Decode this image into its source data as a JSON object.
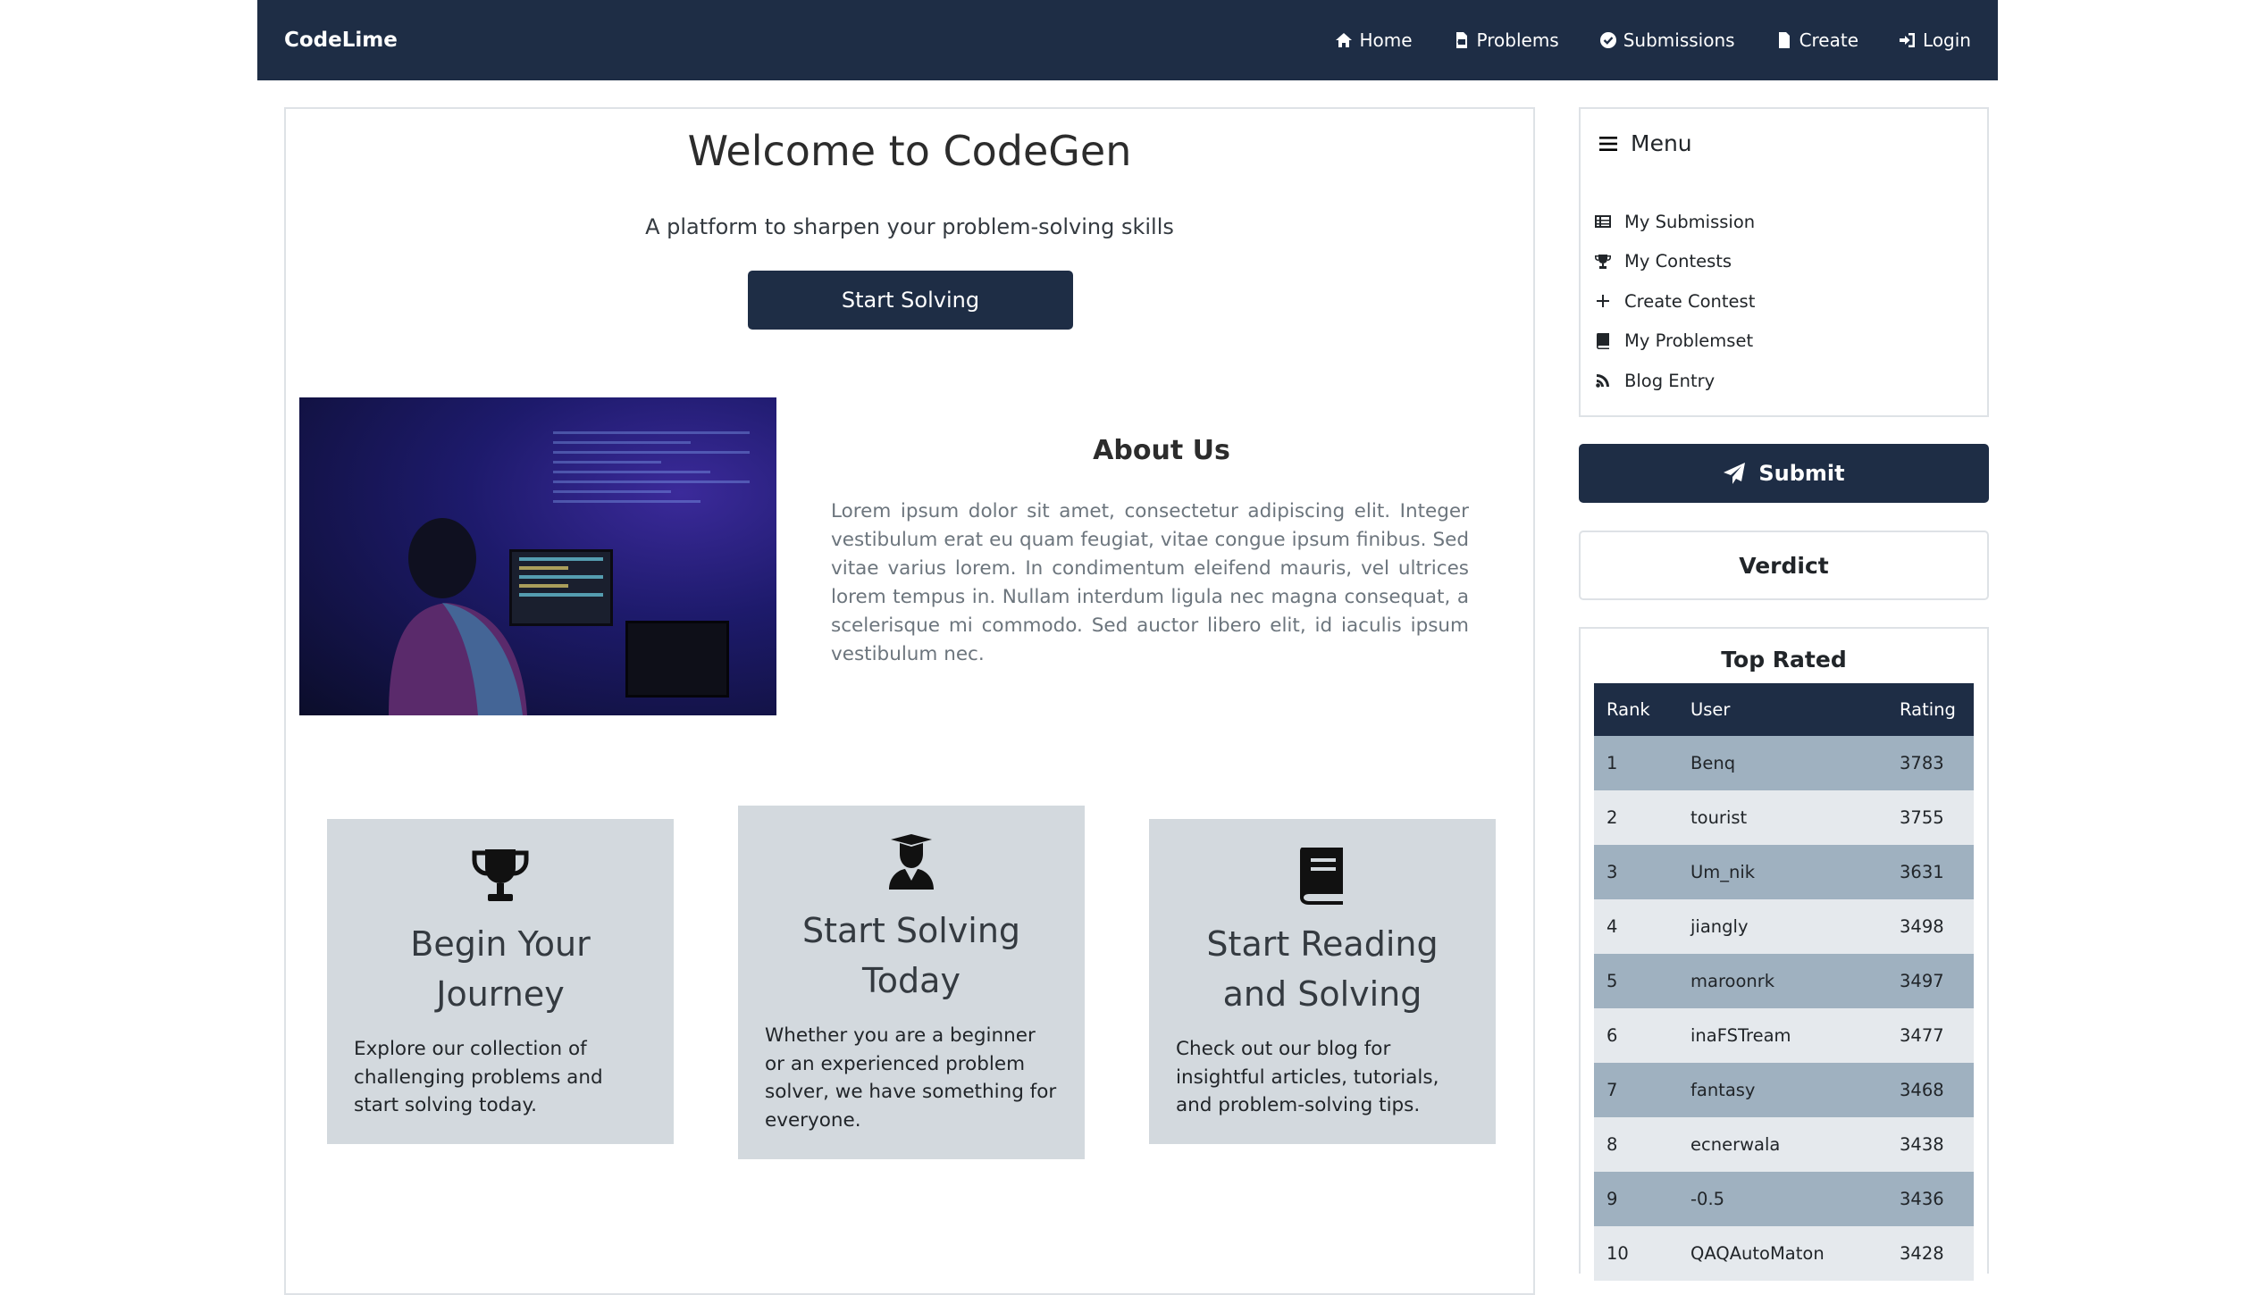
{
  "navbar": {
    "brand": "CodeLime",
    "items": [
      {
        "label": "Home",
        "icon": "home-icon"
      },
      {
        "label": "Problems",
        "icon": "file-code-icon"
      },
      {
        "label": "Submissions",
        "icon": "check-circle-icon"
      },
      {
        "label": "Create",
        "icon": "file-icon"
      },
      {
        "label": "Login",
        "icon": "login-icon"
      }
    ]
  },
  "hero": {
    "title": "Welcome to CodeGen",
    "subtitle": "A platform to sharpen your problem-solving skills",
    "button": "Start Solving"
  },
  "about": {
    "title": "About Us",
    "text": "Lorem ipsum dolor sit amet, consectetur adipiscing elit. Integer vestibulum erat eu quam feugiat, vitae congue ipsum finibus. Sed vitae varius lorem. In condimentum eleifend mauris, vel ultrices lorem tempus in. Nullam interdum ligula nec magna consequat, a scelerisque mi commodo. Sed auctor libero elit, id iaculis ipsum vestibulum nec."
  },
  "cards": [
    {
      "title": "Begin Your Journey",
      "text": "Explore our collection of challenging problems and start solving today.",
      "icon": "trophy-icon"
    },
    {
      "title": "Start Solving Today",
      "text": "Whether you are a beginner or an experienced problem solver, we have something for everyone.",
      "icon": "graduate-icon"
    },
    {
      "title": "Start Reading and Solving",
      "text": "Check out our blog for insightful articles, tutorials, and problem-solving tips.",
      "icon": "book-icon"
    }
  ],
  "menu": {
    "title": "Menu",
    "items": [
      {
        "label": "My Submission",
        "icon": "table-icon"
      },
      {
        "label": "My Contests",
        "icon": "trophy-icon"
      },
      {
        "label": "Create Contest",
        "icon": "plus-icon"
      },
      {
        "label": "My Problemset",
        "icon": "book-icon"
      },
      {
        "label": "Blog Entry",
        "icon": "blog-icon"
      }
    ]
  },
  "submit_label": "Submit",
  "verdict_label": "Verdict",
  "top_rated": {
    "title": "Top Rated",
    "headers": [
      "Rank",
      "User",
      "Rating"
    ],
    "rows": [
      [
        "1",
        "Benq",
        "3783"
      ],
      [
        "2",
        "tourist",
        "3755"
      ],
      [
        "3",
        "Um_nik",
        "3631"
      ],
      [
        "4",
        "jiangly",
        "3498"
      ],
      [
        "5",
        "maroonrk",
        "3497"
      ],
      [
        "6",
        "inaFSTream",
        "3477"
      ],
      [
        "7",
        "fantasy",
        "3468"
      ],
      [
        "8",
        "ecnerwala",
        "3438"
      ],
      [
        "9",
        "-0.5",
        "3436"
      ],
      [
        "10",
        "QAQAutoMaton",
        "3428"
      ]
    ]
  },
  "colors": {
    "primary": "#1e2d45",
    "card_bg": "#d3d9de",
    "row_odd": "#9fb1c0",
    "row_even": "#e5e9ed"
  }
}
